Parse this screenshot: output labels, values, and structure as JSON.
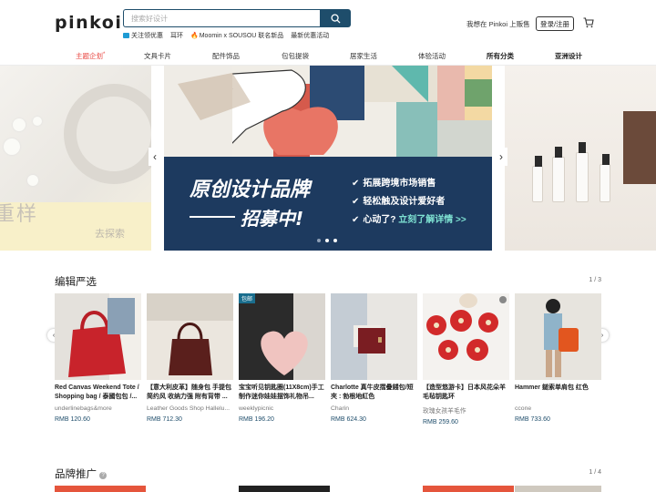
{
  "header": {
    "logo": "pinkoi",
    "search_placeholder": "搜索好设计",
    "quick_links": [
      "关注领优惠",
      "耳环",
      "Moomin x SOUSOU 联名新品",
      "最新优惠活动"
    ],
    "sell_link": "我想在 Pinkoi 上贩售",
    "login": "登录/注册"
  },
  "nav": {
    "items": [
      "主题企划",
      "文具卡片",
      "配件饰品",
      "包包提袋",
      "居家生活",
      "体验活动",
      "所有分类",
      "亚洲设计"
    ],
    "sup": "*"
  },
  "banner": {
    "left_text": "重样",
    "left_explore": "去探索",
    "title": "原创设计品牌",
    "subtitle": "招募中!",
    "bullets": [
      "拓展跨境市场销售",
      "轻松触及设计爱好者"
    ],
    "cta_prefix": "心动了? ",
    "cta": "立刻了解详情 >>"
  },
  "editor_section": {
    "title": "编辑严选",
    "page": "1 / 3",
    "products": [
      {
        "title": "Red Canvas Weekend Tote / Shopping bag / 泰國包包 /...",
        "shop": "underlinebags&more",
        "price": "RMB 120.60"
      },
      {
        "title": "【意大利皮革】随身包 手提包 简约风 收纳力强 附有背带 ...",
        "shop": "Leather Goods Shop Hallelu...",
        "price": "RMB 712.30"
      },
      {
        "title": "宝宝听见钥匙圈(11X8cm)手工制作迷你娃娃摆饰礼物吊...",
        "shop": "weeklypicnic",
        "price": "RMB 196.20",
        "badge": "包邮"
      },
      {
        "title": "Charlotte 真牛皮摺疊錢包/短夾 : 勃根地紅色",
        "shop": "Charin",
        "price": "RMB 624.30"
      },
      {
        "title": "【造型悠游卡】日本风花朵羊毛毡钥匙环",
        "shop": "玫瑰女孩羊毛作",
        "price": "RMB 259.60"
      },
      {
        "title": "Hammer 鎚索单肩包 红色",
        "shop": "ccone",
        "price": "RMB 733.60"
      }
    ]
  },
  "brand_section": {
    "title": "品牌推广",
    "page": "1 / 4"
  },
  "colors": {
    "brand": "#1e4d6b",
    "accent": "#e8433e",
    "banner_bg": "#1d3a5f"
  }
}
